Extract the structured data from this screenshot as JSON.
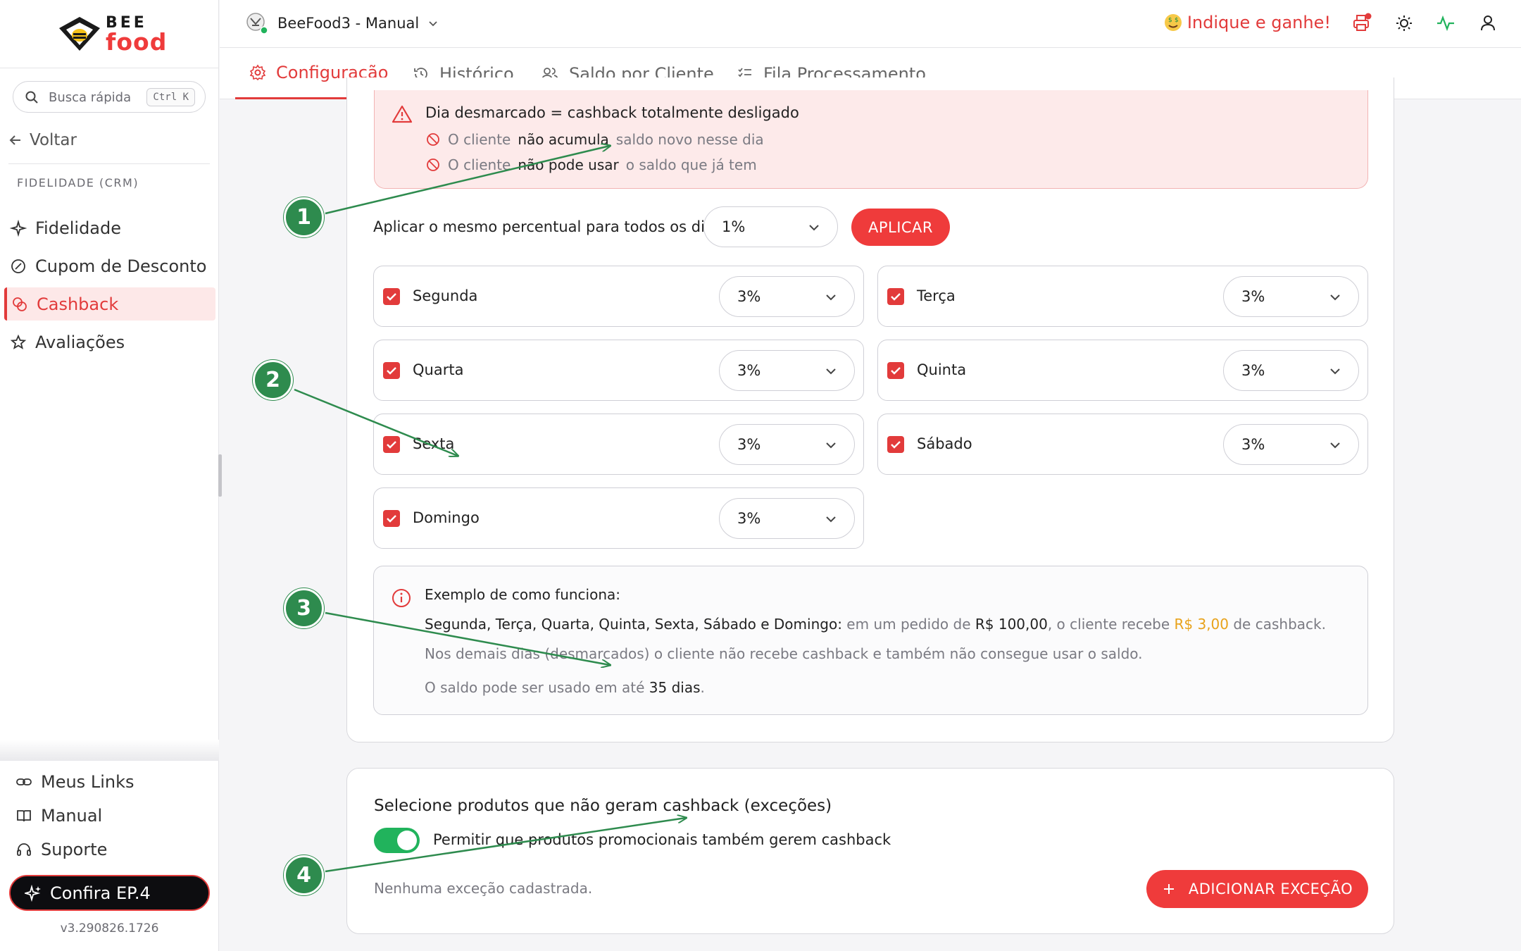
{
  "brand": {
    "bee": "BEE",
    "food": "food",
    "accent": "#e23b3b"
  },
  "sidebar": {
    "search_placeholder": "Busca rápida",
    "search_shortcut": "Ctrl K",
    "back_label": "Voltar",
    "section_label": "FIDELIDADE (CRM)",
    "items": [
      {
        "label": "Fidelidade",
        "icon": "sparkle-icon"
      },
      {
        "label": "Cupom de Desconto",
        "icon": "coupon-icon"
      },
      {
        "label": "Cashback",
        "icon": "coins-icon",
        "active": true
      },
      {
        "label": "Avaliações",
        "icon": "star-icon"
      }
    ],
    "bottom": [
      {
        "label": "Meus Links",
        "icon": "link-icon"
      },
      {
        "label": "Manual",
        "icon": "book-icon"
      },
      {
        "label": "Suporte",
        "icon": "headset-icon"
      }
    ],
    "promo_label": "Confira EP.4",
    "version": "v3.290826.1726"
  },
  "topbar": {
    "store_name": "BeeFood3 - Manual",
    "indique_label": "Indique e ganhe!",
    "icons": [
      "printer-icon",
      "sun-icon",
      "activity-icon",
      "user-icon"
    ]
  },
  "tabs": [
    {
      "label": "Configuração",
      "icon": "gear-icon",
      "active": true
    },
    {
      "label": "Histórico",
      "icon": "history-icon"
    },
    {
      "label": "Saldo por Cliente",
      "icon": "users-icon"
    },
    {
      "label": "Fila Processamento",
      "icon": "list-check-icon"
    }
  ],
  "alert": {
    "title": "Dia desmarcado = cashback totalmente desligado",
    "line1_a": "O cliente",
    "line1_b": "não acumula",
    "line1_c": "saldo novo nesse dia",
    "line2_a": "O cliente",
    "line2_b": "não pode usar",
    "line2_c": "o saldo que já tem"
  },
  "apply_all": {
    "label": "Aplicar o mesmo percentual para todos os dias",
    "value": "1%",
    "button": "APLICAR"
  },
  "days": [
    {
      "name": "Segunda",
      "checked": true,
      "value": "3%"
    },
    {
      "name": "Terça",
      "checked": true,
      "value": "3%"
    },
    {
      "name": "Quarta",
      "checked": true,
      "value": "3%"
    },
    {
      "name": "Quinta",
      "checked": true,
      "value": "3%"
    },
    {
      "name": "Sexta",
      "checked": true,
      "value": "3%"
    },
    {
      "name": "Sábado",
      "checked": true,
      "value": "3%"
    },
    {
      "name": "Domingo",
      "checked": true,
      "value": "3%"
    }
  ],
  "example": {
    "title": "Exemplo de como funciona:",
    "days_label": "Segunda, Terça, Quarta, Quinta, Sexta, Sábado e Domingo:",
    "text_a": "em um pedido de",
    "order_value": "R$ 100,00",
    "text_b": ", o cliente recebe",
    "cashback_value": "R$ 3,00",
    "text_c": "de cashback.",
    "other_days": "Nos demais dias (desmarcados) o cliente não recebe cashback e também não consegue usar o saldo.",
    "validity_a": "O saldo pode ser usado em até",
    "validity_days": "35 dias",
    "validity_end": "."
  },
  "exceptions": {
    "title": "Selecione produtos que não geram cashback (exceções)",
    "toggle_label": "Permitir que produtos promocionais também gerem cashback",
    "toggle_on": true,
    "empty": "Nenhuma exceção cadastrada.",
    "add_button": "ADICIONAR EXCEÇÃO"
  },
  "annotations": [
    "1",
    "2",
    "3",
    "4"
  ]
}
